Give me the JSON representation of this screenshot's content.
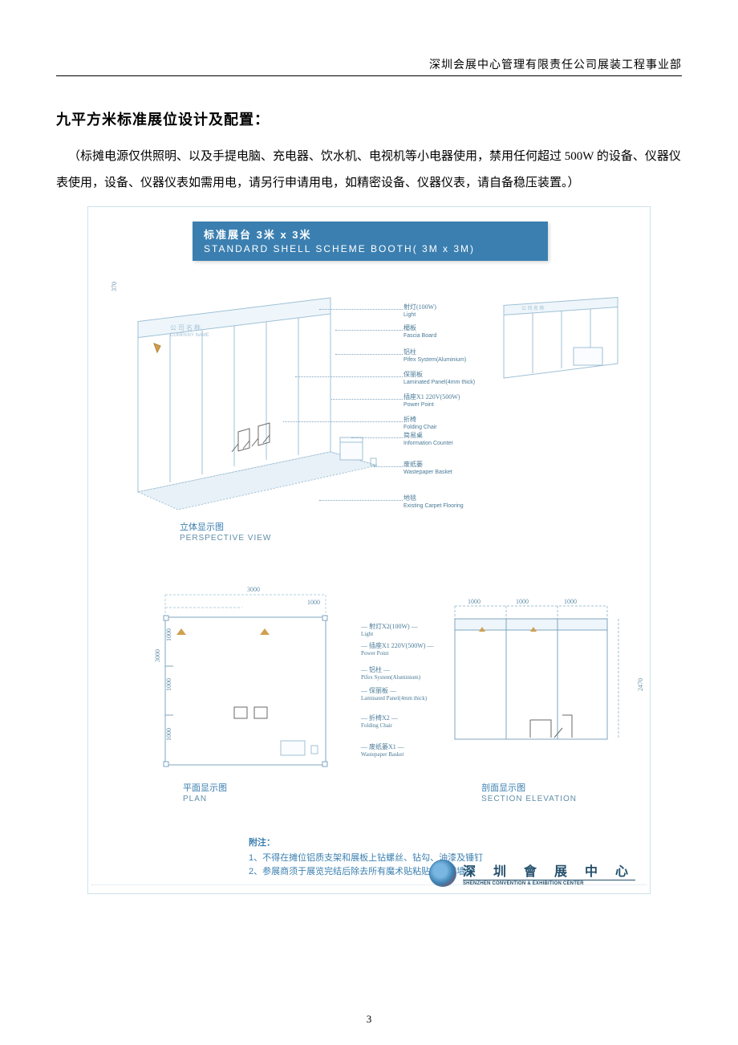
{
  "header": "深圳会展中心管理有限责任公司展装工程事业部",
  "title": "九平方米标准展位设计及配置：",
  "intro": "（标摊电源仅供照明、以及手提电脑、充电器、饮水机、电视机等小电器使用，禁用任何超过 500W 的设备、仪器仪表使用，设备、仪器仪表如需用电，请另行申请用电，如精密设备、仪器仪表，请自备稳压装置。）",
  "diagram": {
    "title_bar_cn": "标准展台   3米 x 3米",
    "title_bar_en": "STANDARD SHELL SCHEME BOOTH( 3M x 3M)",
    "dim_370": "370",
    "company_cn": "公 司 名 称",
    "company_en": "COMPANY NAME",
    "labels": {
      "light_cn": "射灯(100W)",
      "light_en": "Light",
      "fascia_cn": "楣板",
      "fascia_en": "Fascia Board",
      "alu_cn": "铝柱",
      "alu_en": "Pifex System(Aluminium)",
      "panel_cn": "保丽板",
      "panel_en": "Laminated Panel(4mm thick)",
      "power_cn": "插座X1  220V(500W)",
      "power_en": "Power Point",
      "chair_cn": "折椅",
      "chair_en": "Folding Chair",
      "counter_cn": "简易桌",
      "counter_en": "Information Counter",
      "bin_cn": "废纸篓",
      "bin_en": "Wastepaper Basket",
      "carpet_cn": "地毯",
      "carpet_en": "Existing Carpet Flooring"
    },
    "persp_title_cn": "立体显示图",
    "persp_title_en": "PERSPECTIVE VIEW",
    "plan": {
      "dim3000": "3000",
      "dim1000a": "1000",
      "dim1000b": "1000",
      "dim1000c": "1000",
      "dim1000d": "1000",
      "labels": {
        "light_cn": "射灯X2(100W)",
        "light_en": "Light",
        "power_cn": "插座X1  220V(500W)",
        "power_en": "Power Point",
        "alu_cn": "铝柱",
        "alu_en": "Pifex System(Aluminium)",
        "panel_cn": "保丽板",
        "panel_en": "Laminated Panel(4mm thick)",
        "chair_cn": "折椅X2",
        "chair_en": "Folding Chair",
        "bin_cn": "废纸篓X1",
        "bin_en": "Wastepaper Basket"
      },
      "title_cn": "平面显示图",
      "title_en": "PLAN"
    },
    "elev": {
      "dim1000a": "1000",
      "dim1000b": "1000",
      "dim1000c": "1000",
      "dim2470": "2470",
      "title_cn": "剖面显示图",
      "title_en": "SECTION ELEVATION"
    },
    "notes": {
      "head": "附注：",
      "n1": "1、不得在摊位铝质支架和展板上钻螺丝、钻勾、油漆及锤钉",
      "n2": "2、参展商须于展览完结后除去所有魔术贴粘贴海报或墙纸"
    },
    "logo_cn": "深 圳 會 展 中 心",
    "logo_en": "SHENZHEN CONVENTION & EXHIBITION CENTER"
  },
  "page_number": "3"
}
